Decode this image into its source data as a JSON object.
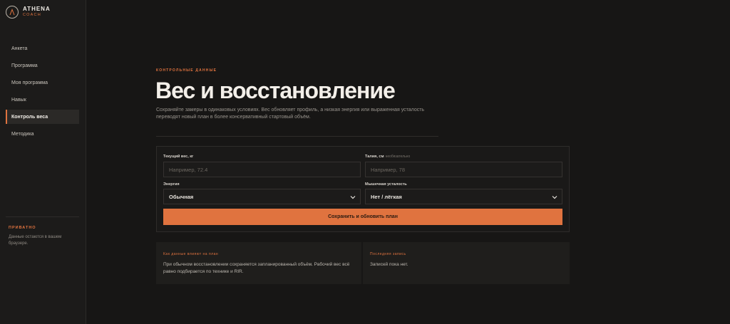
{
  "brand": {
    "name": "ATHENA",
    "sub": "COACH",
    "glyph": "Λ"
  },
  "sidebar": {
    "items": [
      {
        "label": "Анкета",
        "active": false
      },
      {
        "label": "Программа",
        "active": false
      },
      {
        "label": "Моя программа",
        "active": false
      },
      {
        "label": "Навык",
        "active": false
      },
      {
        "label": "Контроль веса",
        "active": true
      },
      {
        "label": "Методика",
        "active": false
      }
    ],
    "private_title": "ПРИВАТНО",
    "private_text": "Данные остаются в вашем браузере."
  },
  "header": {
    "eyebrow": "КОНТРОЛЬНЫЕ ДАННЫЕ",
    "title": "Вес и восстановление",
    "description": "Сохраняйте замеры в одинаковых условиях. Вес обновляет профиль, а низкая энергия или выраженная усталость переводят новый план в более консервативный стартовый объём."
  },
  "form": {
    "weight_label": "Текущий вес, кг",
    "weight_value": "",
    "weight_placeholder": "Например, 72.4",
    "waist_label": "Талия, см",
    "waist_optional": "необязательно",
    "waist_value": "",
    "waist_placeholder": "Например, 78",
    "energy_label": "Энергия",
    "energy_value": "Обычная",
    "fatigue_label": "Мышечная усталость",
    "fatigue_value": "Нет / лёгкая",
    "submit_label": "Сохранить и обновить план"
  },
  "info": {
    "how_title": "Как данные влияют на план",
    "how_text": "При обычном восстановлении сохраняется запланированный объём. Рабочий вес всё равно подбирается по технике и RIR.",
    "last_title": "Последняя запись",
    "last_text": "Записей пока нет."
  },
  "colors": {
    "accent": "#e0733f",
    "background": "#171615",
    "sidebar": "#1c1b1a"
  }
}
